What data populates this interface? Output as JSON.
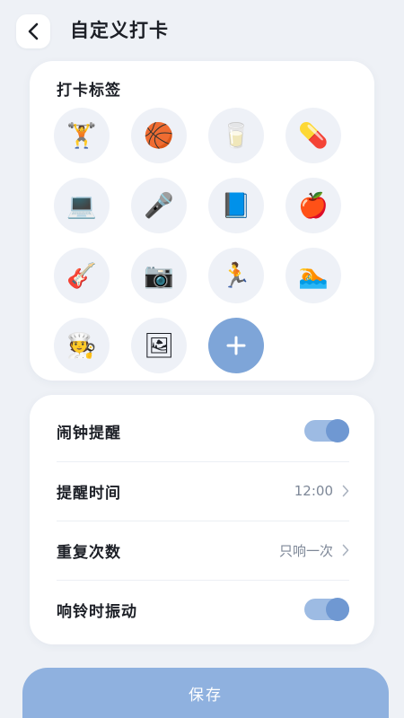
{
  "header": {
    "title": "自定义打卡",
    "back_icon": "chevron-left-icon"
  },
  "tags": {
    "title": "打卡标签",
    "items": [
      {
        "name": "dumbbell-icon",
        "glyph": "🏋"
      },
      {
        "name": "basketball-icon",
        "glyph": "🏀"
      },
      {
        "name": "water-glass-icon",
        "glyph": "🥛"
      },
      {
        "name": "pill-icon",
        "glyph": "💊"
      },
      {
        "name": "laptop-icon",
        "glyph": "💻"
      },
      {
        "name": "microphone-icon",
        "glyph": "🎤"
      },
      {
        "name": "book-icon",
        "glyph": "📘"
      },
      {
        "name": "apple-icon",
        "glyph": "🍎"
      },
      {
        "name": "guitar-icon",
        "glyph": "🎸"
      },
      {
        "name": "camera-icon",
        "glyph": "📷"
      },
      {
        "name": "runner-icon",
        "glyph": "🏃"
      },
      {
        "name": "swimmer-icon",
        "glyph": "🏊"
      },
      {
        "name": "chef-icon",
        "glyph": "🧑‍🍳"
      },
      {
        "name": "painting-icon",
        "glyph": "🖼"
      }
    ],
    "add_icon": "plus-icon"
  },
  "settings": {
    "alarm_label": "闹钟提醒",
    "alarm_on": true,
    "time_label": "提醒时间",
    "time_value": "12:00",
    "repeat_label": "重复次数",
    "repeat_value": "只响一次",
    "vibrate_label": "响铃时振动",
    "vibrate_on": true
  },
  "save_label": "保存",
  "colors": {
    "background": "#eef1f6",
    "accent": "#7ea5d8",
    "toggle_track": "#9dbbe3",
    "toggle_knob": "#6f98d2",
    "save_button": "#8fb1df",
    "secondary_text": "#7d8797"
  }
}
